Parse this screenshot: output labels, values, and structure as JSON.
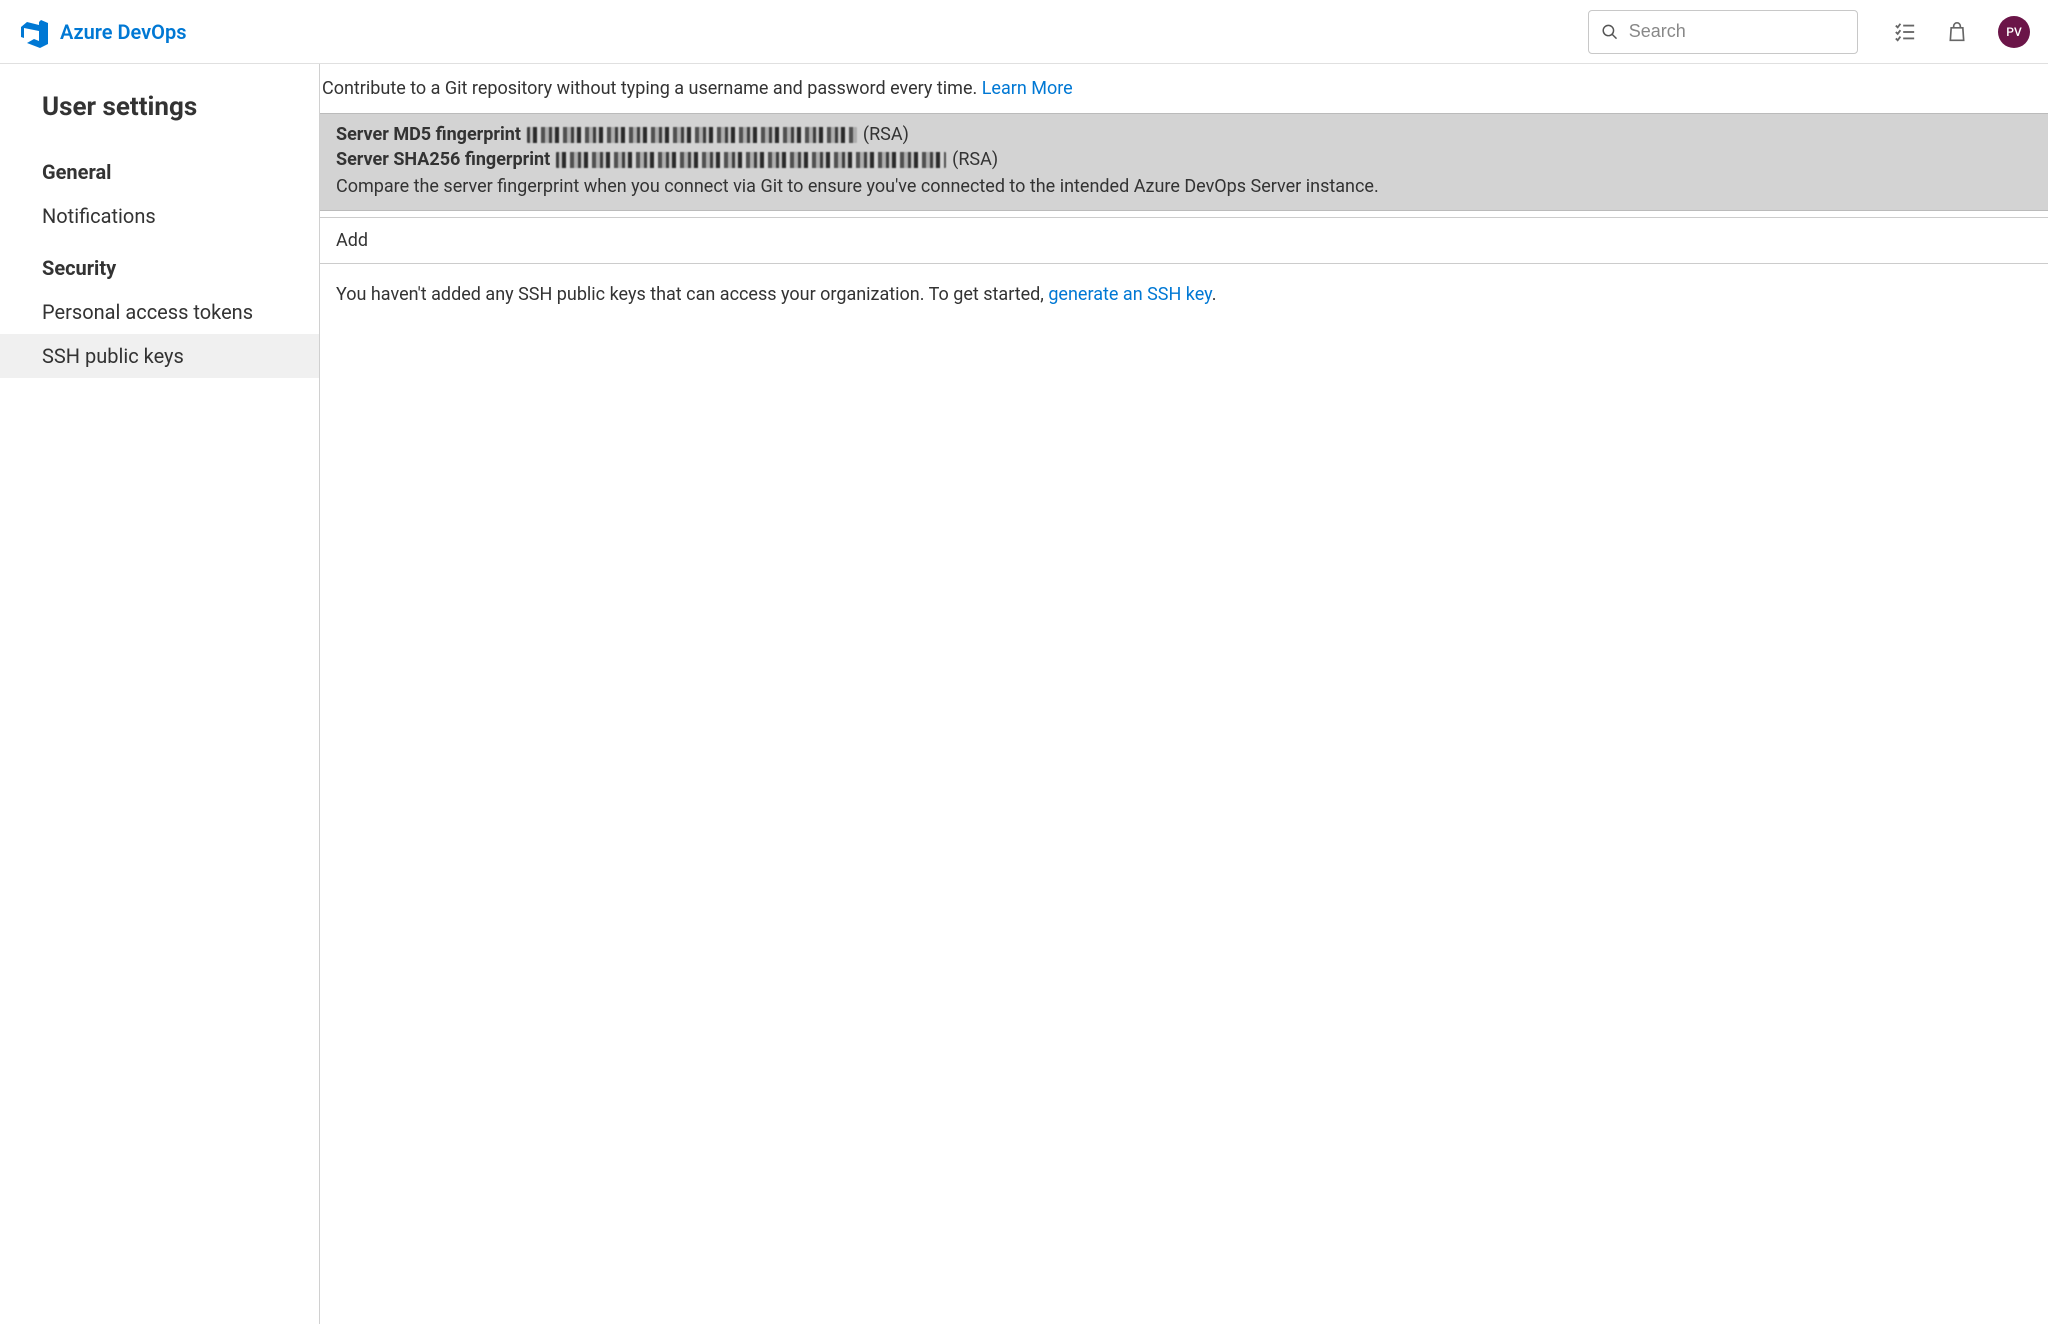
{
  "header": {
    "brand": "Azure DevOps",
    "search_placeholder": "Search",
    "avatar_initials": "PV"
  },
  "sidebar": {
    "title": "User settings",
    "sections": [
      {
        "label": "General",
        "items": [
          {
            "label": "Notifications",
            "active": false
          }
        ]
      },
      {
        "label": "Security",
        "items": [
          {
            "label": "Personal access tokens",
            "active": false
          },
          {
            "label": "SSH public keys",
            "active": true
          }
        ]
      }
    ]
  },
  "main": {
    "intro_text": "Contribute to a Git repository without typing a username and password every time. ",
    "learn_more": "Learn More",
    "fingerprint": {
      "md5_label": "Server MD5 fingerprint",
      "md5_suffix": "(RSA)",
      "sha_label": "Server SHA256 fingerprint",
      "sha_suffix": "(RSA)",
      "compare_text": "Compare the server fingerprint when you connect via Git to ensure you've connected to the intended Azure DevOps Server instance."
    },
    "add_button": "Add",
    "empty_prefix": "You haven't added any SSH public keys that can access your organization. To get started, ",
    "empty_link": "generate an SSH key",
    "empty_suffix": "."
  }
}
